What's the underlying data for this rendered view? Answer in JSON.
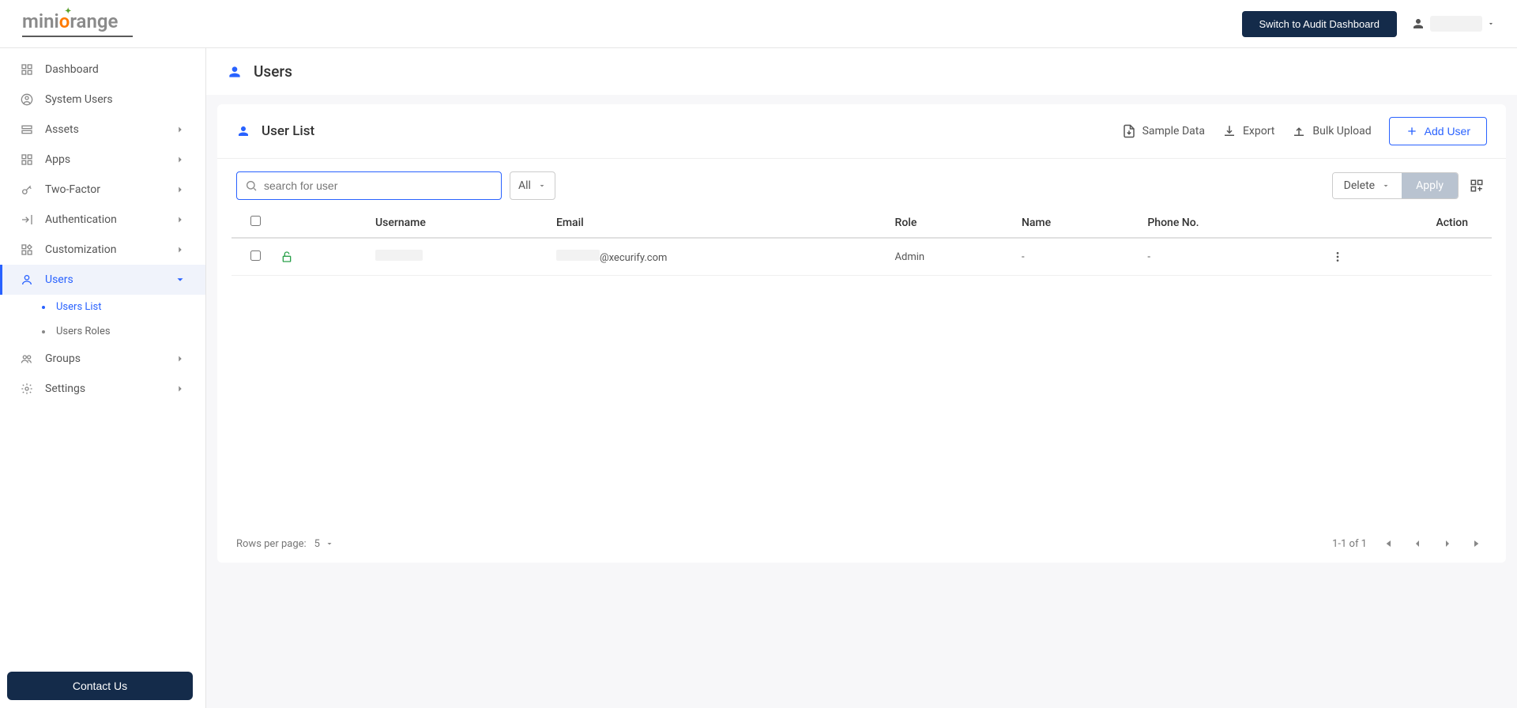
{
  "header": {
    "logo_text": "miniorange",
    "audit_btn": "Switch to Audit Dashboard"
  },
  "sidebar": {
    "items": [
      {
        "label": "Dashboard"
      },
      {
        "label": "System Users"
      },
      {
        "label": "Assets"
      },
      {
        "label": "Apps"
      },
      {
        "label": "Two-Factor"
      },
      {
        "label": "Authentication"
      },
      {
        "label": "Customization"
      },
      {
        "label": "Users"
      },
      {
        "label": "Groups"
      },
      {
        "label": "Settings"
      }
    ],
    "sub_users": [
      {
        "label": "Users List"
      },
      {
        "label": "Users Roles"
      }
    ],
    "contact": "Contact Us"
  },
  "page": {
    "title": "Users",
    "card_title": "User List",
    "actions": {
      "sample": "Sample Data",
      "export": "Export",
      "bulk": "Bulk Upload",
      "add": "Add User"
    },
    "search_placeholder": "search for user",
    "filter_all": "All",
    "delete": "Delete",
    "apply": "Apply",
    "columns": {
      "username": "Username",
      "email": "Email",
      "role": "Role",
      "name": "Name",
      "phone": "Phone No.",
      "action": "Action"
    },
    "rows": [
      {
        "username": "",
        "email": "@xecurify.com",
        "role": "Admin",
        "name": "-",
        "phone": "-"
      }
    ],
    "footer": {
      "rpp_label": "Rows per page:",
      "rpp_value": "5",
      "range": "1-1 of 1"
    }
  }
}
